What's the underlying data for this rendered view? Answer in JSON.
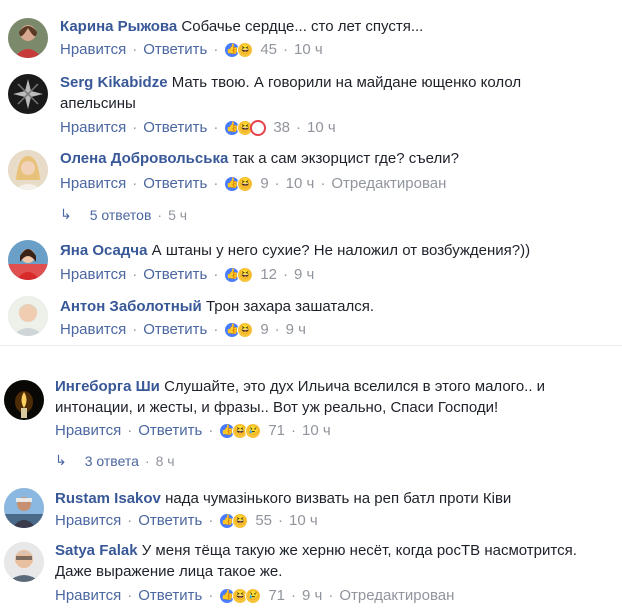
{
  "actions": {
    "like": "Нравится",
    "reply": "Ответить",
    "sep": "·",
    "edited": "Отредактирован"
  },
  "comments": [
    {
      "author": "Карина Рыжова",
      "text": "Собачье сердце... сто лет спустя...",
      "reactions": [
        "like-icon",
        "haha-icon"
      ],
      "count": "45",
      "time": "10 ч"
    },
    {
      "author": "Serg Kikabidze",
      "text": "Мать твою. А говорили на майдане ющенко колол апельсины",
      "reactions": [
        "like-icon",
        "haha-icon",
        "angry-icon"
      ],
      "count": "38",
      "time": "10 ч"
    },
    {
      "author": "Олена Добровольська",
      "text": "так а сам экзорцист где? съели?",
      "reactions": [
        "like-icon",
        "haha-icon"
      ],
      "count": "9",
      "time": "10 ч",
      "edited": true
    },
    {
      "author": "Яна Осадча",
      "text": "А штаны у него сухие? Не наложил от возбуждения?))",
      "reactions": [
        "like-icon",
        "haha-icon"
      ],
      "count": "12",
      "time": "9 ч"
    },
    {
      "author": "Антон Заболотный",
      "text": "Трон захара зашатался.",
      "reactions": [
        "like-icon",
        "haha-icon"
      ],
      "count": "9",
      "time": "9 ч"
    },
    {
      "author": "Ингеборга Ши",
      "text": "Слушайте, это дух Ильича вселился в этого малого.. и интонации, и жесты, и фразы.. Вот уж реально, Спаси Господи!",
      "reactions": [
        "like-icon",
        "haha-icon",
        "sad-icon"
      ],
      "count": "71",
      "time": "10 ч"
    },
    {
      "author": "Rustam Isakov",
      "text": "нада чумазінького визвать на реп батл проти Ківи",
      "reactions": [
        "like-icon",
        "haha-icon"
      ],
      "count": "55",
      "time": "10 ч"
    },
    {
      "author": "Satya Falak",
      "text": "У меня тёща такую же херню несёт, когда росТВ насмотрится. Даже выражение лица такое же.",
      "reactions": [
        "like-icon",
        "haha-icon",
        "sad-icon"
      ],
      "count": "71",
      "time": "9 ч",
      "edited": true
    }
  ],
  "replies": [
    {
      "label": "5 ответов",
      "time": "5 ч"
    },
    {
      "label": "3 ответа",
      "time": "8 ч"
    }
  ]
}
